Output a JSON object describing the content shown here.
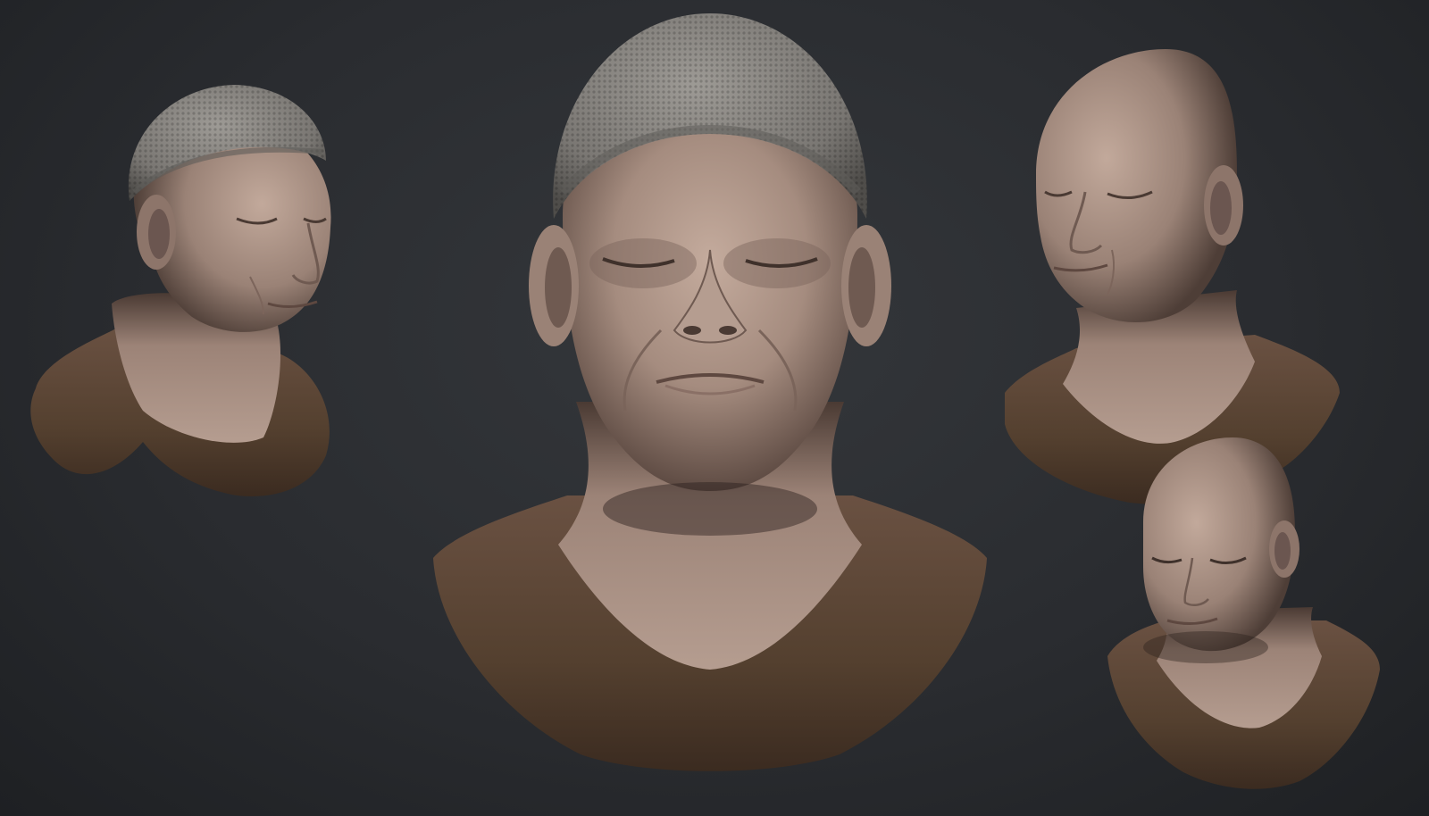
{
  "scene": {
    "background_color": "#2c2e32",
    "busts": [
      {
        "view": "three-quarter-left",
        "hat": "knit-beanie"
      },
      {
        "view": "front",
        "hat": "knit-beanie"
      },
      {
        "view": "three-quarter-right",
        "hat": "none"
      },
      {
        "view": "three-quarter-right-tilted-down",
        "hat": "none"
      }
    ],
    "colors": {
      "skin": "#b39a8c",
      "skin_shadow": "#6f5a51",
      "shirt": "#5a4335",
      "shirt_shadow": "#3a2a20",
      "beanie": "#8c8985",
      "beanie_dark": "#5e5c59"
    }
  }
}
